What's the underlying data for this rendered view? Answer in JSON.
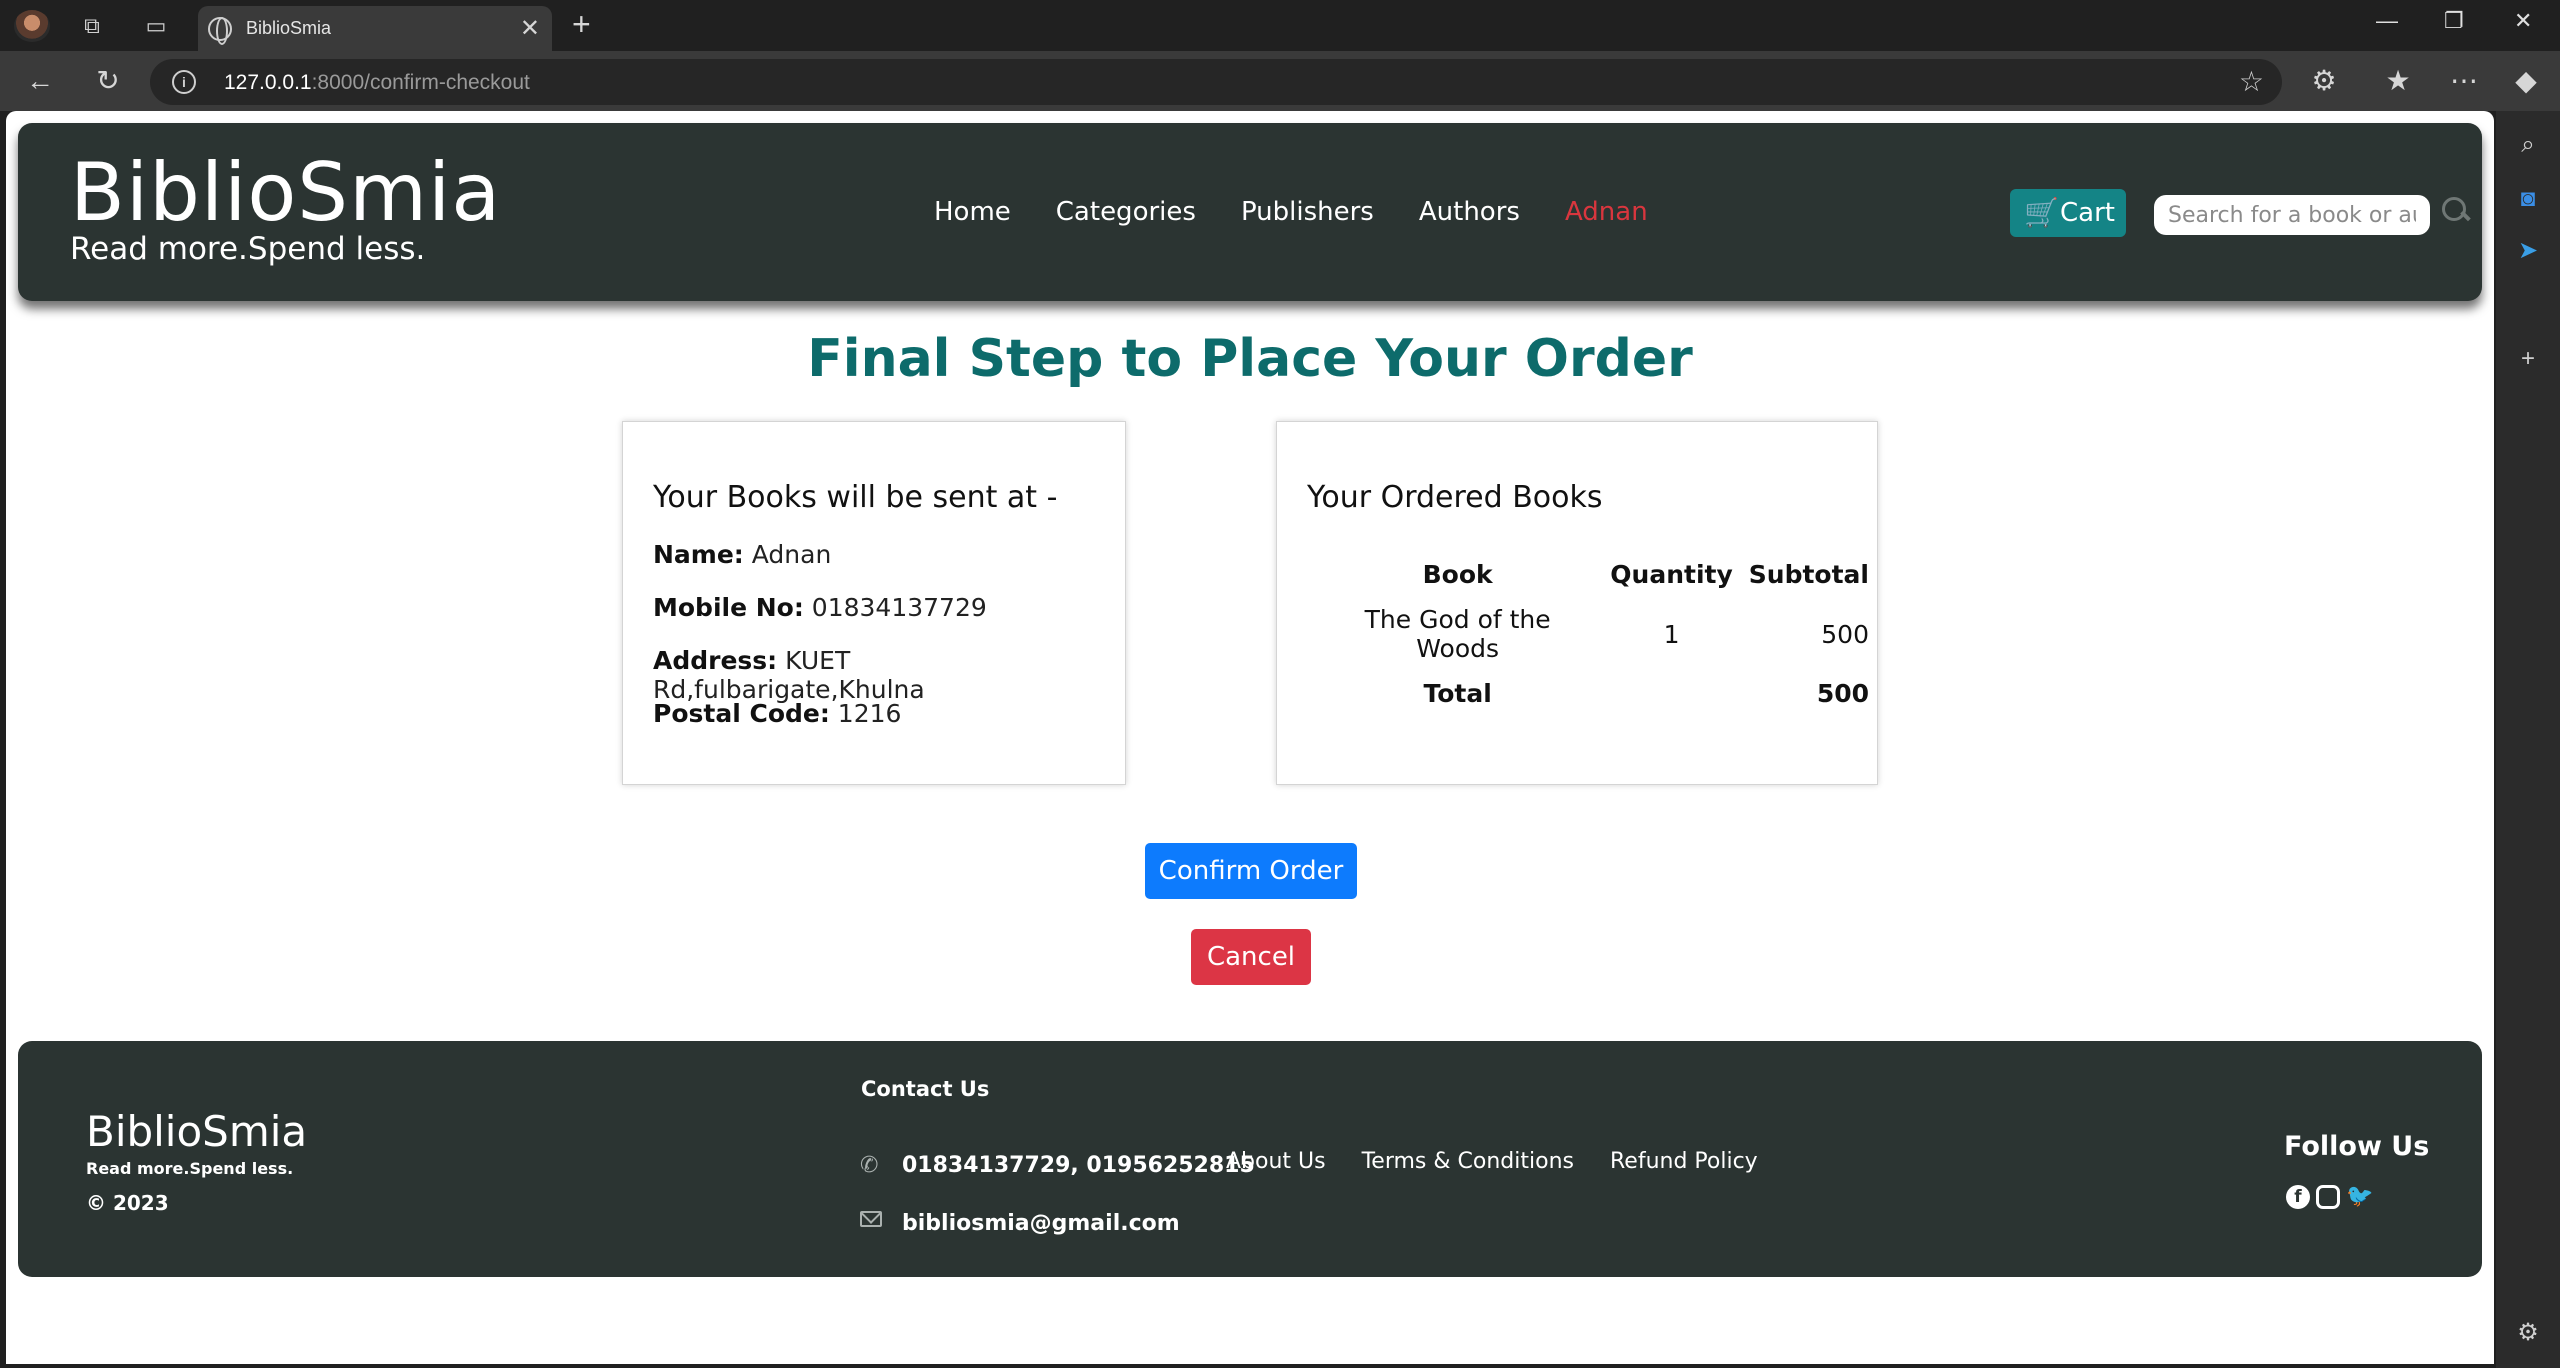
{
  "browser": {
    "tab_title": "BiblioSmia",
    "url_host": "127.0.0.1",
    "url_rest": ":8000/confirm-checkout"
  },
  "header": {
    "brand": "BiblioSmia",
    "tagline": "Read more.Spend less.",
    "nav": [
      "Home",
      "Categories",
      "Publishers",
      "Authors",
      "Adnan"
    ],
    "cart_label": "Cart",
    "search_placeholder": "Search for a book or author"
  },
  "page": {
    "title": "Final Step to Place Your Order"
  },
  "shipping": {
    "heading": "Your Books will be sent at -",
    "name_label": "Name:",
    "name": "Adnan",
    "mobile_label": "Mobile No:",
    "mobile": "01834137729",
    "address_label": "Address:",
    "address": "KUET Rd,fulbarigate,Khulna",
    "postal_label": "Postal Code:",
    "postal": "1216"
  },
  "order": {
    "heading": "Your Ordered Books",
    "columns": [
      "Book",
      "Quantity",
      "Subtotal"
    ],
    "rows": [
      {
        "book": "The God of the Woods",
        "quantity": "1",
        "subtotal": "500"
      }
    ],
    "total_label": "Total",
    "total": "500"
  },
  "actions": {
    "confirm": "Confirm Order",
    "cancel": "Cancel"
  },
  "footer": {
    "brand": "BiblioSmia",
    "tagline": "Read more.Spend less.",
    "copyright": "© 2023",
    "contact_heading": "Contact Us",
    "phones": "01834137729, 01956252815",
    "email": "bibliosmia@gmail.com",
    "links": [
      "About Us",
      "Terms & Conditions",
      "Refund Policy"
    ],
    "follow_heading": "Follow Us",
    "social_icons": [
      "facebook-icon",
      "instagram-icon",
      "twitter-icon"
    ]
  },
  "colors": {
    "header_bg": "#2b3432",
    "title": "#0d6b6b",
    "cart": "#148486",
    "confirm": "#0d7bfd",
    "cancel": "#dc3545",
    "active_user": "#d9363e"
  }
}
